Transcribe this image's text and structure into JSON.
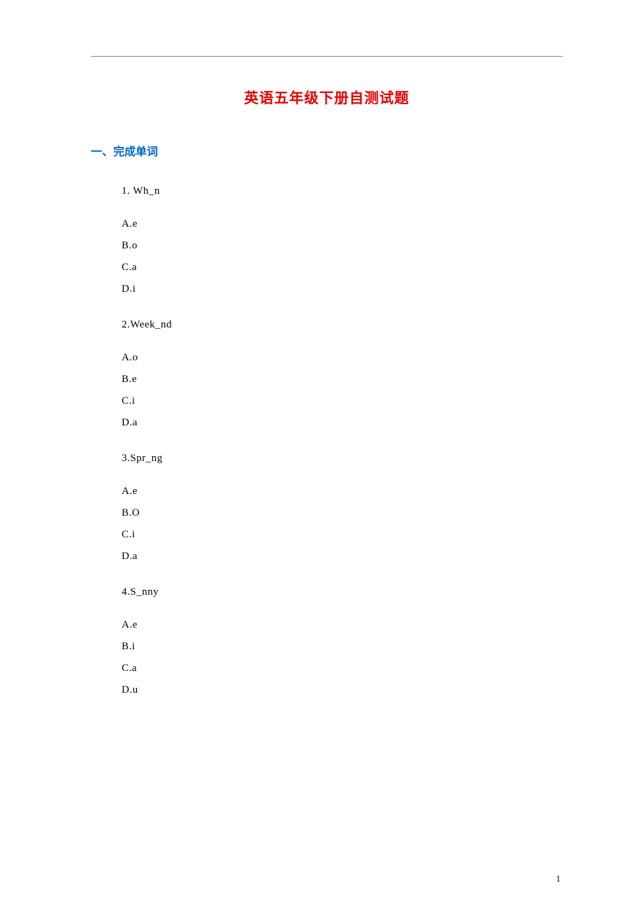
{
  "title": {
    "text": "英语五年级下册自测试题",
    "color": "#e60000"
  },
  "section": {
    "heading": "一、完成单词",
    "color": "#0066cc"
  },
  "questions": [
    {
      "number": "1. ",
      "word": "Wh_n",
      "options": [
        {
          "label": "A.",
          "value": "e"
        },
        {
          "label": "B.",
          "value": "o"
        },
        {
          "label": "C.",
          "value": "a"
        },
        {
          "label": "D.",
          "value": "i"
        }
      ]
    },
    {
      "number": "2.",
      "word": "Week_nd",
      "options": [
        {
          "label": "A.",
          "value": "o"
        },
        {
          "label": "B.",
          "value": "e"
        },
        {
          "label": "C.",
          "value": "i"
        },
        {
          "label": "D.",
          "value": "a"
        }
      ]
    },
    {
      "number": "3.",
      "word": "Spr_ng",
      "options": [
        {
          "label": "A.",
          "value": "e"
        },
        {
          "label": "B.",
          "value": "O"
        },
        {
          "label": "C.",
          "value": "i"
        },
        {
          "label": "D.",
          "value": "a"
        }
      ]
    },
    {
      "number": "4.",
      "word": "S_nny",
      "options": [
        {
          "label": "A.",
          "value": "e"
        },
        {
          "label": "B.",
          "value": "i"
        },
        {
          "label": "C.",
          "value": "a"
        },
        {
          "label": "D.",
          "value": "u"
        }
      ]
    }
  ],
  "page_number": "1"
}
